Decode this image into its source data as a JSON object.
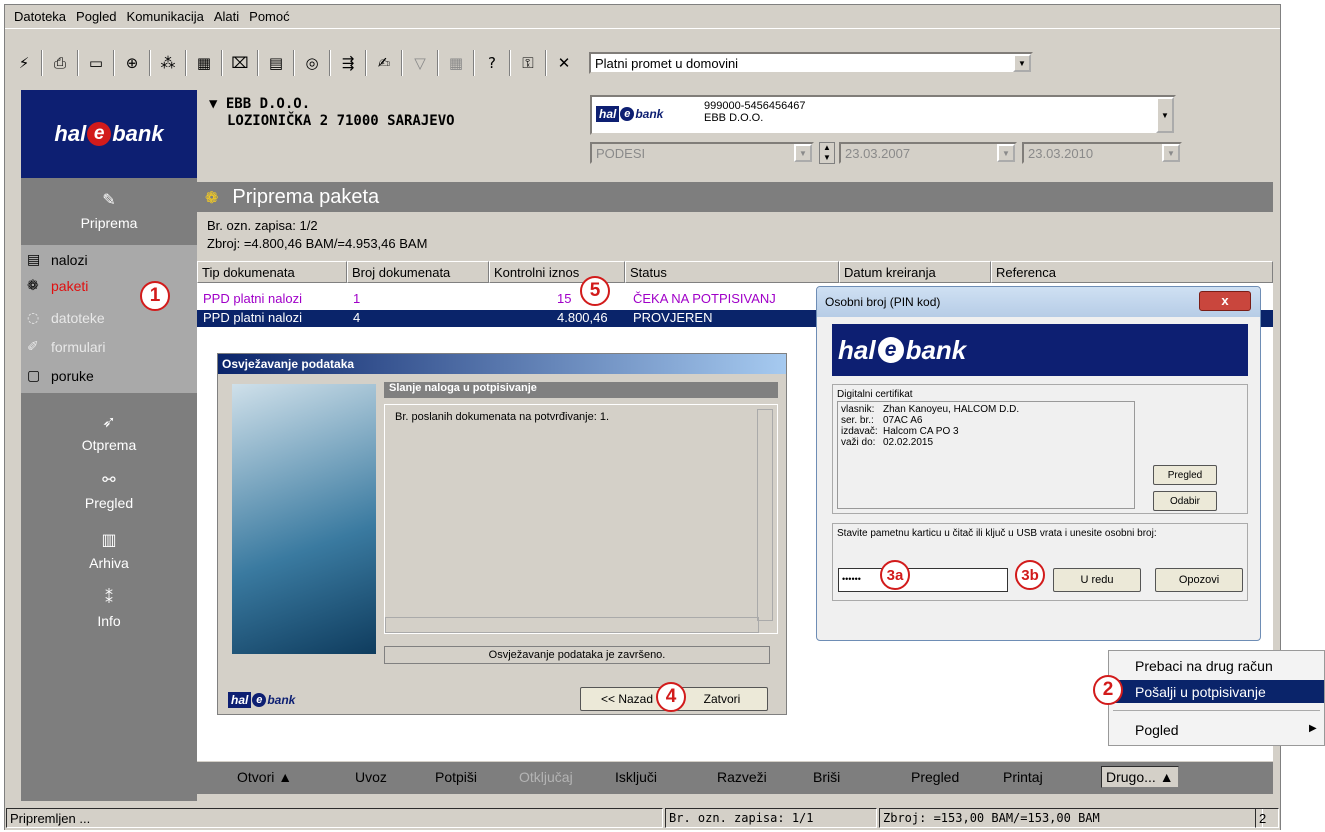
{
  "menu": [
    "Datoteka",
    "Pogled",
    "Komunikacija",
    "Alati",
    "Pomoć"
  ],
  "toolbar": {
    "icons": [
      "lightning-icon",
      "printer-icon",
      "book-icon",
      "globe-icon",
      "numbers-icon",
      "calculator-icon",
      "print-preview-icon",
      "form-icon",
      "disc-icon",
      "send-icon",
      "edit-icon",
      "filter-icon",
      "calc-icon",
      "help-icon",
      "key-icon",
      "close-icon"
    ],
    "service_combo": "Platni promet u domovini"
  },
  "brand": {
    "part1": "hal",
    "e": "e",
    "part2": "bank"
  },
  "sidebar": {
    "categories": [
      {
        "label": "Priprema",
        "icon": "✎"
      },
      {
        "label": "Otprema",
        "icon": "➶"
      },
      {
        "label": "Pregled",
        "icon": "⚯"
      },
      {
        "label": "Arhiva",
        "icon": "▥"
      },
      {
        "label": "Info",
        "icon": "⁑"
      }
    ],
    "items": [
      {
        "label": "nalozi",
        "icon": "▤"
      },
      {
        "label": "paketi",
        "icon": "❁"
      },
      {
        "label": "datoteke",
        "icon": "◌"
      },
      {
        "label": "formulari",
        "icon": "✐"
      },
      {
        "label": "poruke",
        "icon": "▢"
      }
    ]
  },
  "header": {
    "company_line1": "▼ EBB D.O.O.",
    "company_line2": "LOZIONIČKA 2 71000 SARAJEVO",
    "account_number": "999000-5456456467",
    "account_name": "EBB D.O.O.",
    "filter": "PODESI",
    "date_from": "23.03.2007",
    "date_to": "23.03.2010"
  },
  "page": {
    "title": "Priprema paketa",
    "record_count": "Br. ozn. zapisa: 1/2",
    "sum": "Zbroj: =4.800,46 BAM/=4.953,46 BAM"
  },
  "table": {
    "columns": [
      "Tip dokumenata",
      "Broj dokumenata",
      "Kontrolni iznos",
      "Status",
      "Datum kreiranja",
      "Referenca"
    ],
    "rows": [
      {
        "tip": "PPD platni nalozi",
        "broj": "1",
        "iznos": "15",
        "status": "ČEKA NA POTPISIVANJ"
      },
      {
        "tip": "PPD platni nalozi",
        "broj": "4",
        "iznos": "4.800,46",
        "status": "PROVJEREN"
      }
    ]
  },
  "refresh_dialog": {
    "title": "Osvježavanje podataka",
    "section": "Slanje naloga u potpisivanje",
    "message": "Br. poslanih dokumenata na potvrđivanje: 1.",
    "status": "Osvježavanje podataka je završeno.",
    "back": "<< Nazad",
    "close": "Zatvori"
  },
  "pin_dialog": {
    "title": "Osobni broj (PIN kod)",
    "cert_title": "Digitalni certifikat",
    "cert_fields": [
      {
        "key": "vlasnik:",
        "val": "Zhan Kanoyeu, HALCOM D.D."
      },
      {
        "key": "ser. br.:",
        "val": "07AC A6"
      },
      {
        "key": "izdavač:",
        "val": "Halcom CA PO 3"
      },
      {
        "key": "važi do:",
        "val": "02.02.2015"
      }
    ],
    "view": "Pregled",
    "select": "Odabir",
    "instruction": "Stavite pametnu karticu u čitač ili ključ u USB vrata i unesite osobni broj:",
    "pin_value": "••••••",
    "ok": "U redu",
    "cancel": "Opozovi"
  },
  "context_menu": [
    "Prebaci na drug račun",
    "Pošalji u potpisivanje",
    "Pogled"
  ],
  "bottom_bar": [
    "Otvori ▲",
    "Uvoz",
    "Potpiši",
    "Otključaj",
    "Isključi",
    "Razveži",
    "Briši",
    "Pregled",
    "Printaj",
    "Drugo... ▲"
  ],
  "statusbar": {
    "ready": "Pripremljen ...",
    "records": "Br. ozn. zapisa: 1/1",
    "sum": "Zbroj: =153,00 BAM/=153,00 BAM",
    "page": "2"
  },
  "markers": [
    "1",
    "2",
    "3a",
    "3b",
    "4",
    "5"
  ],
  "colors": {
    "brand_navy": "#0d1f72",
    "brand_red": "#d21b1b",
    "selection": "#0a246a",
    "row_purple": "#a000c8"
  }
}
